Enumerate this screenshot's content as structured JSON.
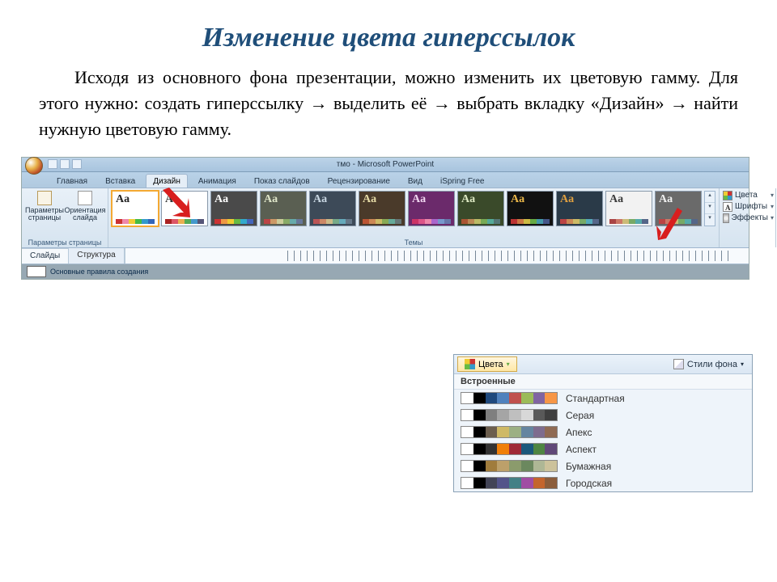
{
  "title": "Изменение цвета гиперссылок",
  "paragraph_html": "Исходя из основного фона презентации, можно изменить их цветовую гамму. Для этого нужно: создать гиперссылку → выделить её → выбрать вкладку «Дизайн» → найти нужную цветовую гамму.",
  "window_title": "тмо - Microsoft PowerPoint",
  "tabs": {
    "home": "Главная",
    "insert": "Вставка",
    "design": "Дизайн",
    "animations": "Анимация",
    "slideshow": "Показ слайдов",
    "review": "Рецензирование",
    "view": "Вид",
    "ispring": "iSpring Free"
  },
  "page_setup": {
    "page_params": "Параметры\nстраницы",
    "orientation": "Ориентация\nслайда",
    "group_label": "Параметры страницы"
  },
  "themes": {
    "group_label": "Темы",
    "tools": {
      "colors": "Цвета",
      "fonts": "Шрифты",
      "effects": "Эффекты"
    },
    "items": [
      {
        "bg": "#ffffff",
        "fg": "#222222",
        "sw": [
          "#c33",
          "#e8a",
          "#ec3",
          "#4b4",
          "#39c",
          "#36b"
        ]
      },
      {
        "bg": "#ffffff",
        "fg": "#333333",
        "sw": [
          "#a22",
          "#d56",
          "#e9b050",
          "#5a5",
          "#49c",
          "#557"
        ]
      },
      {
        "bg": "#4a4a4a",
        "fg": "#ffffff",
        "sw": [
          "#c33",
          "#e94",
          "#ec3",
          "#6b4",
          "#3ac",
          "#46b"
        ]
      },
      {
        "bg": "#5a5f52",
        "fg": "#dfe6c9",
        "sw": [
          "#b44",
          "#c96",
          "#cc9",
          "#8a6",
          "#6aa",
          "#679"
        ]
      },
      {
        "bg": "#3d4a58",
        "fg": "#c9d7e2",
        "sw": [
          "#b55",
          "#c86",
          "#cb8",
          "#7a8",
          "#6ab",
          "#678"
        ]
      },
      {
        "bg": "#4a3a2a",
        "fg": "#e6dba6",
        "sw": [
          "#b53",
          "#c85",
          "#cb6",
          "#8a5",
          "#6a9",
          "#677"
        ]
      },
      {
        "bg": "#6b2a6b",
        "fg": "#f0d6f0",
        "sw": [
          "#c36",
          "#d58",
          "#e8a",
          "#a6c",
          "#79c",
          "#67a"
        ]
      },
      {
        "bg": "#3a4a2a",
        "fg": "#dce8c2",
        "sw": [
          "#a53",
          "#b85",
          "#bb6",
          "#7a5",
          "#5a9",
          "#577"
        ]
      },
      {
        "bg": "#111111",
        "fg": "#ecb84a",
        "sw": [
          "#b33",
          "#c74",
          "#cb4",
          "#6a4",
          "#49a",
          "#458"
        ]
      },
      {
        "bg": "#2a3a48",
        "fg": "#e0a040",
        "sw": [
          "#b44",
          "#c85",
          "#cb6",
          "#7a6",
          "#5ab",
          "#568"
        ]
      },
      {
        "bg": "#f2f2f2",
        "fg": "#3a3a3a",
        "sw": [
          "#a44",
          "#c76",
          "#cb7",
          "#7a6",
          "#5aa",
          "#568"
        ]
      },
      {
        "bg": "#6a6a6a",
        "fg": "#f0f0f0",
        "sw": [
          "#b44",
          "#c76",
          "#cb7",
          "#7a6",
          "#5aa",
          "#568"
        ]
      }
    ]
  },
  "pane_tabs": {
    "slides": "Слайды",
    "outline": "Структура"
  },
  "mini_slide_label": "Основные правила создания",
  "colors_panel": {
    "button": "Цвета",
    "bg_styles": "Стили фона",
    "header": "Встроенные",
    "schemes": [
      {
        "name": "Стандартная",
        "sw": [
          "#ffffff",
          "#000000",
          "#1f497d",
          "#4f81bd",
          "#c0504d",
          "#9bbb59",
          "#8064a2",
          "#f79646"
        ]
      },
      {
        "name": "Серая",
        "sw": [
          "#ffffff",
          "#000000",
          "#7f7f7f",
          "#a5a5a5",
          "#bfbfbf",
          "#d8d8d8",
          "#595959",
          "#3f3f3f"
        ]
      },
      {
        "name": "Апекс",
        "sw": [
          "#ffffff",
          "#000000",
          "#6b5e4e",
          "#ceb966",
          "#9cb084",
          "#6585a0",
          "#7e6c8e",
          "#8f6a53"
        ]
      },
      {
        "name": "Аспект",
        "sw": [
          "#ffffff",
          "#000000",
          "#323232",
          "#f07f09",
          "#9f2936",
          "#1b587c",
          "#4e8542",
          "#604878"
        ]
      },
      {
        "name": "Бумажная",
        "sw": [
          "#ffffff",
          "#000000",
          "#a07c3c",
          "#bca06a",
          "#8b9b6c",
          "#6b885e",
          "#aeb795",
          "#ccc29b"
        ]
      },
      {
        "name": "Городская",
        "sw": [
          "#ffffff",
          "#000000",
          "#424456",
          "#53548a",
          "#438086",
          "#a04da3",
          "#c4652d",
          "#8b5d3b"
        ]
      }
    ]
  }
}
